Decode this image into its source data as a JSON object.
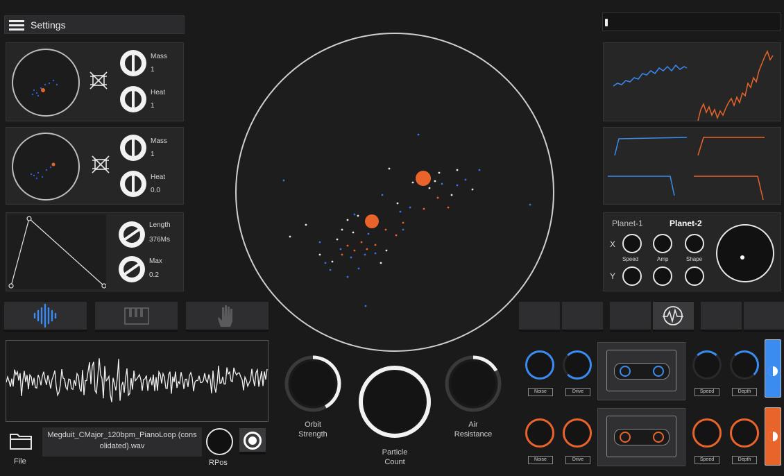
{
  "header": {
    "menu_label": "Settings"
  },
  "orbit_panels": [
    {
      "mass_label": "Mass",
      "mass_value": "1",
      "heat_label": "Heat",
      "heat_value": "1"
    },
    {
      "mass_label": "Mass",
      "mass_value": "1",
      "heat_label": "Heat",
      "heat_value": "0.0"
    }
  ],
  "envelope": {
    "length_label": "Length",
    "length_value": "376Ms",
    "max_label": "Max",
    "max_value": "0.2"
  },
  "planet_panel": {
    "tab1": "Planet-1",
    "tab2": "Planet-2",
    "x_label": "X",
    "y_label": "Y",
    "speed_label": "Speed",
    "amp_label": "Amp",
    "shape_label": "Shape"
  },
  "bottom_controls": {
    "orbit_strength": "Orbit\nStrength",
    "particle_count": "Particle\nCount",
    "air_resistance": "Air\nResistance"
  },
  "file": {
    "file_label": "File",
    "filename": "Megduit_CMajor_120bpm_PianoLoop (consolidated).wav",
    "rpos_label": "RPos"
  },
  "fx_rows": [
    {
      "noise": "Noise",
      "drive": "Drive",
      "speed": "Speed",
      "depth": "Depth",
      "color": "#2f7df0"
    },
    {
      "noise": "Noise",
      "drive": "Drive",
      "speed": "Speed",
      "depth": "Depth",
      "color": "#f06a2a"
    }
  ],
  "icons": {
    "menu": "hamburger-icon",
    "waveform_tab": "waveform-icon",
    "piano_tab": "piano-icon",
    "hand_tab": "hand-icon",
    "folder": "folder-icon",
    "lfo": "oscillator-icon"
  },
  "colors": {
    "blue": "#3a8cf0",
    "orange": "#e8642a",
    "bg": "#1a1a1b"
  }
}
